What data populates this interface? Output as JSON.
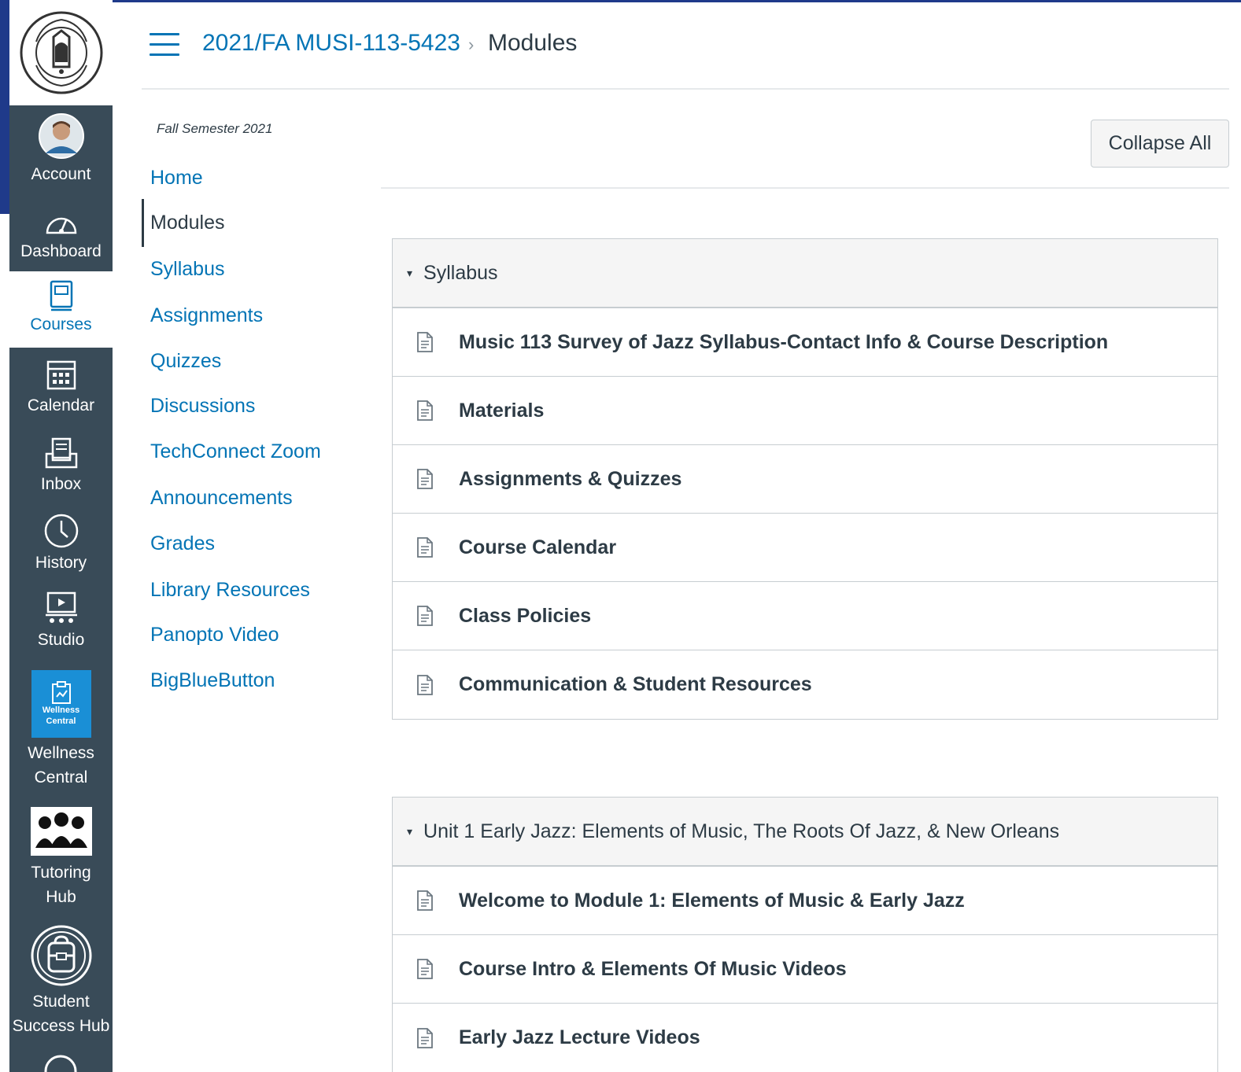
{
  "global_nav": {
    "logo_text": "EL CAMINO COLLEGE",
    "items": [
      {
        "label": "Account",
        "icon": "avatar"
      },
      {
        "label": "Dashboard",
        "icon": "dashboard-icon"
      },
      {
        "label": "Courses",
        "icon": "courses-icon"
      },
      {
        "label": "Calendar",
        "icon": "calendar-icon"
      },
      {
        "label": "Inbox",
        "icon": "inbox-icon"
      },
      {
        "label": "History",
        "icon": "history-icon"
      },
      {
        "label": "Studio",
        "icon": "studio-icon"
      },
      {
        "label_line1": "Wellness",
        "label_line2": "Central",
        "tile_line1": "Wellness",
        "tile_line2": "Central",
        "icon": "wellness-central-icon"
      },
      {
        "label_line1": "Tutoring",
        "label_line2": "Hub",
        "icon": "tutoring-hub-icon"
      },
      {
        "label_line1": "Student",
        "label_line2": "Success Hub",
        "icon": "student-success-hub-icon"
      }
    ],
    "active": "Courses"
  },
  "header": {
    "course": "2021/FA MUSI-113-5423",
    "separator": "›",
    "current": "Modules"
  },
  "course_nav": {
    "term": "Fall Semester 2021",
    "items": [
      {
        "label": "Home"
      },
      {
        "label": "Modules"
      },
      {
        "label": "Syllabus"
      },
      {
        "label": "Assignments"
      },
      {
        "label": "Quizzes"
      },
      {
        "label": "Discussions"
      },
      {
        "label": "TechConnect Zoom"
      },
      {
        "label": "Announcements"
      },
      {
        "label": "Grades"
      },
      {
        "label": "Library Resources"
      },
      {
        "label": "Panopto Video"
      },
      {
        "label": "BigBlueButton"
      }
    ],
    "active": "Modules"
  },
  "toolbar": {
    "collapse_label": "Collapse All"
  },
  "modules": [
    {
      "title": "Syllabus",
      "caret": "▾",
      "items": [
        {
          "title": "Music 113 Survey of Jazz Syllabus-Contact Info & Course Description",
          "icon": "page-icon"
        },
        {
          "title": "Materials",
          "icon": "page-icon"
        },
        {
          "title": "Assignments & Quizzes",
          "icon": "page-icon"
        },
        {
          "title": "Course Calendar",
          "icon": "page-icon"
        },
        {
          "title": "Class Policies",
          "icon": "page-icon"
        },
        {
          "title": "Communication & Student Resources",
          "icon": "page-icon"
        }
      ]
    },
    {
      "title": "Unit 1 Early Jazz: Elements of Music, The Roots Of Jazz, & New Orleans",
      "caret": "▾",
      "items": [
        {
          "title": "Welcome to Module 1: Elements of Music & Early Jazz",
          "icon": "page-icon"
        },
        {
          "title": "Course Intro & Elements Of Music Videos",
          "icon": "page-icon"
        },
        {
          "title": "Early Jazz Lecture Videos",
          "icon": "page-icon"
        }
      ]
    }
  ],
  "colors": {
    "nav_bg": "#394b58",
    "link": "#0374b5",
    "text": "#2d3b45",
    "frame": "#1f3a8a",
    "wellness_tile": "#1a8fd6"
  }
}
